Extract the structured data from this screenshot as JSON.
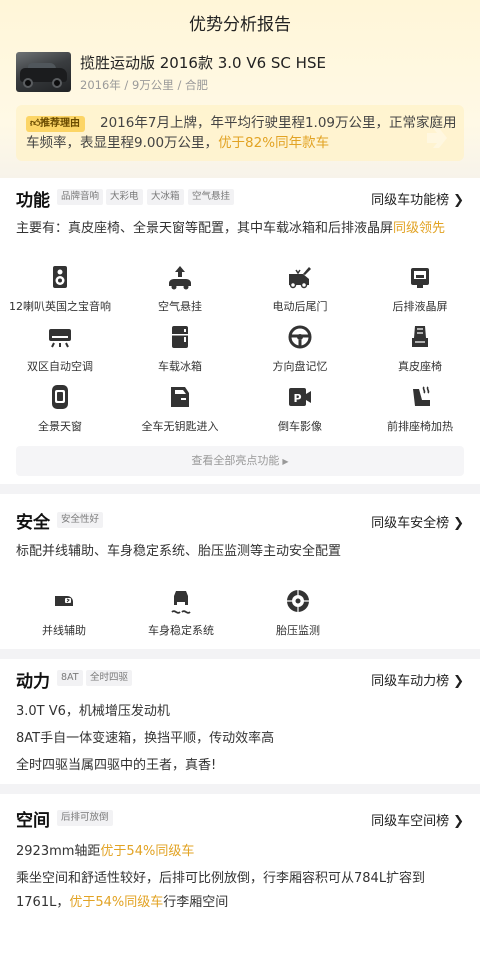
{
  "header": {
    "title": "优势分析报告"
  },
  "car": {
    "name": "揽胜运动版 2016款 3.0 V6 SC HSE",
    "year": "2016年",
    "mileage": "9万公里",
    "city": "合肥",
    "sep": " / "
  },
  "recommend": {
    "badge": "推荐理由",
    "text_plain": "2016年7月上牌，年平均行驶里程1.09万公里，正常家庭用车频率，表显里程9.00万公里，",
    "text_highlight": "优于82%同年款车"
  },
  "function": {
    "title": "功能",
    "tags": [
      "品牌音响",
      "大彩电",
      "大冰箱",
      "空气悬挂"
    ],
    "rank_label": "同级车功能榜",
    "desc_plain": "主要有：真皮座椅、全景天窗等配置，其中车载冰箱和后排液晶屏",
    "desc_highlight": "同级领先",
    "features": [
      {
        "label": "12喇叭英国之宝音响",
        "icon": "speaker-icon"
      },
      {
        "label": "空气悬挂",
        "icon": "air-suspension-icon"
      },
      {
        "label": "电动后尾门",
        "icon": "power-tailgate-icon"
      },
      {
        "label": "后排液晶屏",
        "icon": "rear-screen-icon"
      },
      {
        "label": "双区自动空调",
        "icon": "ac-icon"
      },
      {
        "label": "车载冰箱",
        "icon": "fridge-icon"
      },
      {
        "label": "方向盘记忆",
        "icon": "steering-wheel-icon"
      },
      {
        "label": "真皮座椅",
        "icon": "leather-seat-icon"
      },
      {
        "label": "全景天窗",
        "icon": "sunroof-icon"
      },
      {
        "label": "全车无钥匙进入",
        "icon": "keyless-entry-icon"
      },
      {
        "label": "倒车影像",
        "icon": "reverse-camera-icon"
      },
      {
        "label": "前排座椅加热",
        "icon": "seat-heating-icon"
      }
    ],
    "more_label": "查看全部亮点功能"
  },
  "safety": {
    "title": "安全",
    "tags": [
      "安全性好"
    ],
    "rank_label": "同级车安全榜",
    "desc": "标配并线辅助、车身稳定系统、胎压监测等主动安全配置",
    "features": [
      {
        "label": "并线辅助",
        "icon": "lane-assist-icon"
      },
      {
        "label": "车身稳定系统",
        "icon": "stability-icon"
      },
      {
        "label": "胎压监测",
        "icon": "tire-pressure-icon"
      }
    ]
  },
  "power": {
    "title": "动力",
    "tags": [
      "8AT",
      "全时四驱"
    ],
    "rank_label": "同级车动力榜",
    "lines": [
      "3.0T V6，机械增压发动机",
      "8AT手自一体变速箱，换挡平顺，传动效率高",
      "全时四驱当属四驱中的王者，真香!"
    ]
  },
  "space": {
    "title": "空间",
    "tags": [
      "后排可放倒"
    ],
    "rank_label": "同级车空间榜",
    "line1_plain": "2923mm轴距",
    "line1_highlight": "优于54%同级车",
    "line2_plain_a": "乘坐空间和舒适性较好，后排可比例放倒，行李厢容积可从784L扩容到1761L，",
    "line2_highlight": "优于54%同级车",
    "line2_plain_b": "行李厢空间"
  },
  "colors": {
    "accent": "#e2a324",
    "badge": "#fcd566",
    "icon": "#333333"
  }
}
